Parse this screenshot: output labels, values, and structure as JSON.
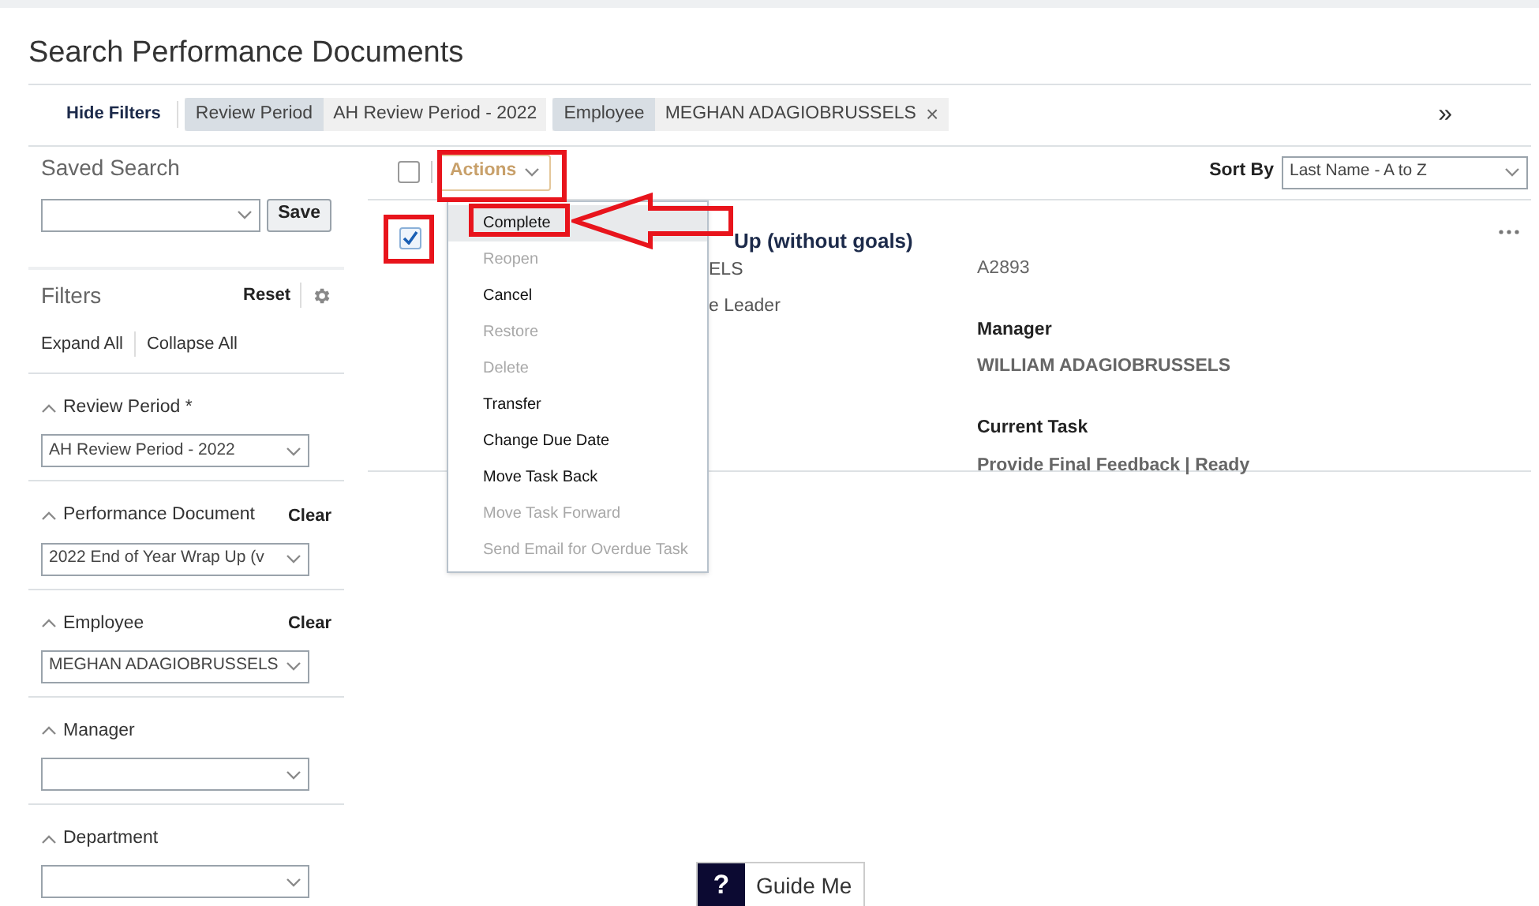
{
  "page": {
    "title": "Search Performance Documents"
  },
  "filter_bar": {
    "toggle": "Hide Filters",
    "chips": [
      {
        "label": "Review Period",
        "value": "AH Review Period - 2022"
      },
      {
        "label": "Employee",
        "value": "MEGHAN ADAGIOBRUSSELS",
        "remove": "×"
      }
    ],
    "more": "»"
  },
  "saved_search": {
    "title": "Saved Search",
    "save": "Save"
  },
  "filters": {
    "title": "Filters",
    "reset": "Reset",
    "expand_all": "Expand All",
    "collapse_all": "Collapse All",
    "sections": [
      {
        "label": "Review Period *",
        "value": "AH Review Period - 2022",
        "expanded": true
      },
      {
        "label": "Performance Document",
        "value": "2022 End of Year Wrap Up (v",
        "clear": "Clear",
        "expanded": true
      },
      {
        "label": "Employee",
        "value": "MEGHAN ADAGIOBRUSSELS",
        "clear": "Clear",
        "expanded": true
      },
      {
        "label": "Manager",
        "expanded": true
      },
      {
        "label": "Department",
        "expanded": true
      }
    ]
  },
  "results": {
    "select_all": {
      "checked": false
    },
    "actions": "Actions",
    "sort_label": "Sort By",
    "sort_value": "Last Name - A to Z",
    "menu": [
      {
        "label": "Complete",
        "disabled": false,
        "selected": true
      },
      {
        "label": "Reopen",
        "disabled": true,
        "selected": false
      },
      {
        "label": "Cancel",
        "disabled": false,
        "selected": false
      },
      {
        "label": "Restore",
        "disabled": true,
        "selected": false
      },
      {
        "label": "Delete",
        "disabled": true,
        "selected": false
      },
      {
        "label": "Transfer",
        "disabled": false,
        "selected": false
      },
      {
        "label": "Change Due Date",
        "disabled": false,
        "selected": false
      },
      {
        "label": "Move Task Back",
        "disabled": false,
        "selected": false
      },
      {
        "label": "Move Task Forward",
        "disabled": true,
        "selected": false
      },
      {
        "label": "Send Email for Overdue Task",
        "disabled": true,
        "selected": false
      }
    ],
    "card": {
      "checked": true,
      "title": "Up (without goals)",
      "name": "ELS",
      "role": "e Leader",
      "id": "A2893",
      "fields": [
        {
          "label": "Manager",
          "value": "WILLIAM ADAGIOBRUSSELS"
        },
        {
          "label": "Current Task",
          "value": "Provide Final Feedback | Ready"
        }
      ]
    }
  },
  "guide": {
    "icon": "?",
    "label": "Guide Me"
  }
}
